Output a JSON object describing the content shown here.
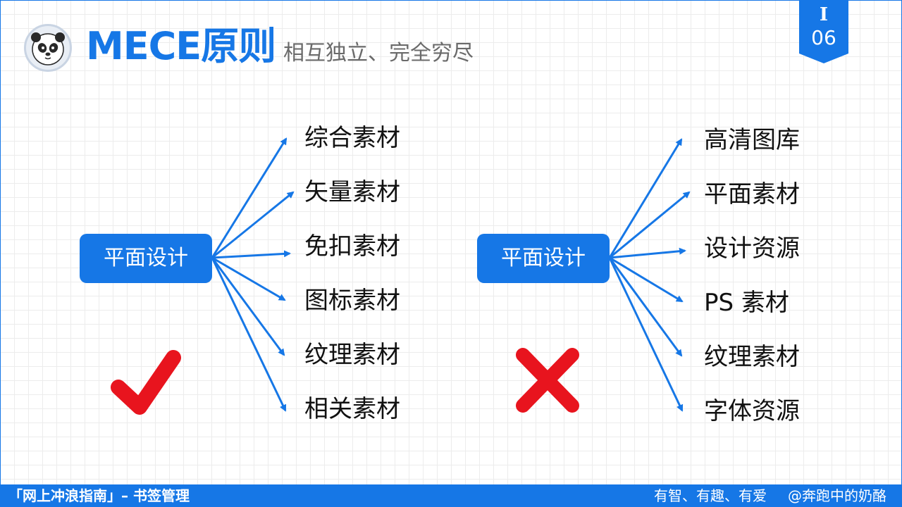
{
  "header": {
    "title": "MECE原则",
    "subtitle": "相互独立、完全穷尽",
    "section_roman": "I",
    "section_number": "06"
  },
  "left_diagram": {
    "root": "平面设计",
    "branches": [
      "综合素材",
      "矢量素材",
      "免扣素材",
      "图标素材",
      "纹理素材",
      "相关素材"
    ],
    "verdict_icon": "checkmark-icon"
  },
  "right_diagram": {
    "root": "平面设计",
    "branches": [
      "高清图库",
      "平面素材",
      "设计资源",
      "PS 素材",
      "纹理素材",
      "字体资源"
    ],
    "verdict_icon": "cross-icon"
  },
  "footer": {
    "left": "「网上冲浪指南」– 书签管理",
    "motto": "有智、有趣、有爱",
    "author": "@奔跑中的奶酪"
  },
  "colors": {
    "accent": "#1677e6",
    "check": "#e8141e",
    "cross": "#e8141e"
  }
}
